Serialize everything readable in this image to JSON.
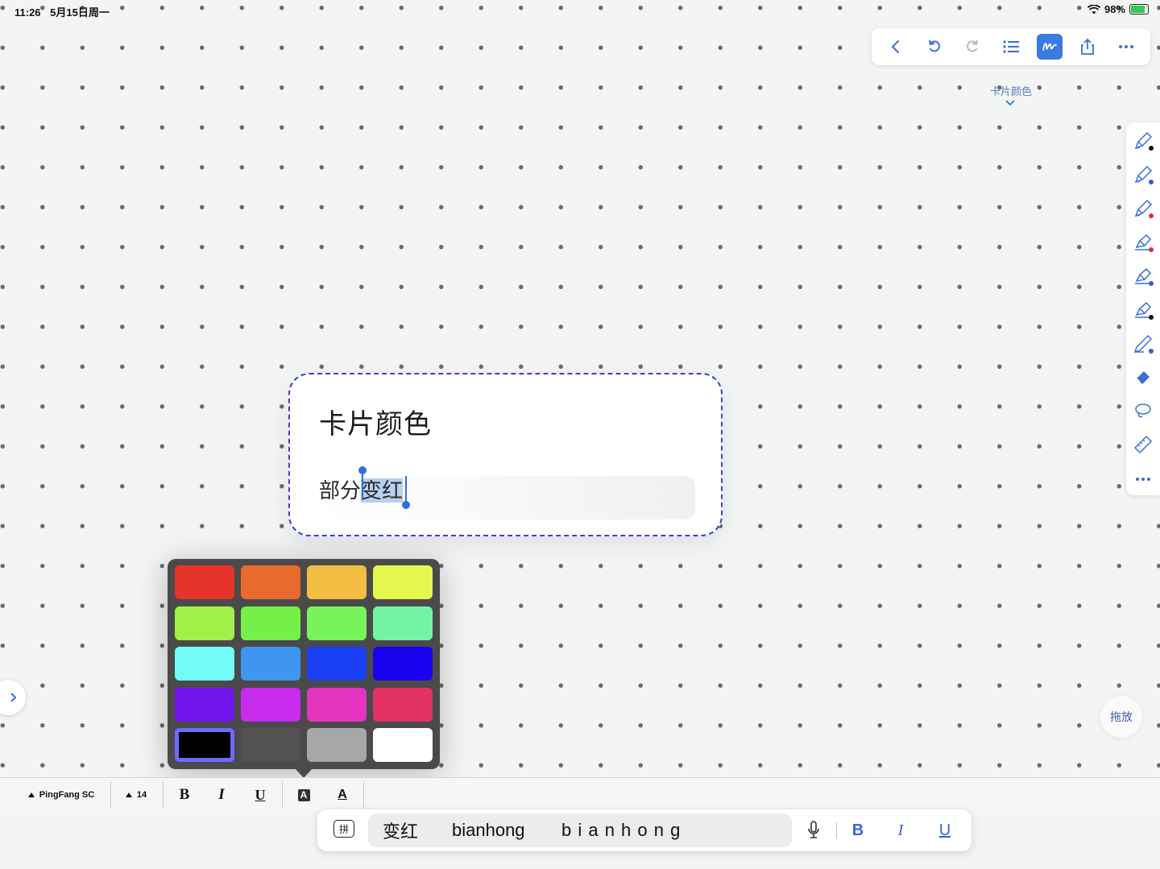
{
  "status_bar": {
    "time": "11:26",
    "date": "5月15日周一",
    "battery": "98%"
  },
  "top_toolbar": {
    "icons": [
      "back-icon",
      "undo-icon",
      "redo-icon",
      "outline-list-icon",
      "handwriting-icon",
      "share-icon",
      "more-icon"
    ],
    "active": "handwriting-icon"
  },
  "card_label": "卡片颜色",
  "right_palette": {
    "tools": [
      {
        "icon": "pen-icon",
        "dot_color": "#111111"
      },
      {
        "icon": "pen-icon",
        "dot_color": "#2f5ee0"
      },
      {
        "icon": "pen-icon",
        "dot_color": "#e03030"
      },
      {
        "icon": "highlighter-icon",
        "dot_color": "#e03030"
      },
      {
        "icon": "highlighter-icon",
        "dot_color": "#2f5ee0"
      },
      {
        "icon": "highlighter-icon",
        "dot_color": "#111111"
      },
      {
        "icon": "pencil-icon",
        "dot_color": "#2f5ee0"
      },
      {
        "icon": "eraser-icon",
        "dot_color": ""
      },
      {
        "icon": "lasso-icon",
        "dot_color": ""
      },
      {
        "icon": "ruler-icon",
        "dot_color": ""
      },
      {
        "icon": "more-icon",
        "dot_color": ""
      }
    ]
  },
  "card": {
    "title": "卡片颜色",
    "body_plain": "部分",
    "body_selected": "变红"
  },
  "color_palette": {
    "swatches": [
      "#e6332a",
      "#ea6a2e",
      "#f3bd44",
      "#e5f74f",
      "#a3f04a",
      "#76ef49",
      "#79f35c",
      "#74f3a5",
      "#72fbf8",
      "#3e96f0",
      "#1a3ef5",
      "#1b02ef",
      "#7216ed",
      "#c82bee",
      "#e434c0",
      "#e43264",
      "#000000",
      "#525252",
      "#a7a7a7",
      "#ffffff"
    ],
    "selected_index": 16
  },
  "format_bar": {
    "font_name": "PingFang SC",
    "font_size": "14",
    "bold": "B",
    "italic": "I",
    "underline": "U",
    "highlight_letter": "A",
    "text_color_letter": "A"
  },
  "ime_bar": {
    "mode_key": "拼",
    "candidates": [
      "变红",
      "bianhong"
    ],
    "composition": "b i a n h o n g",
    "bold": "B",
    "italic": "I",
    "underline": "U"
  },
  "drag_button": "拖放"
}
